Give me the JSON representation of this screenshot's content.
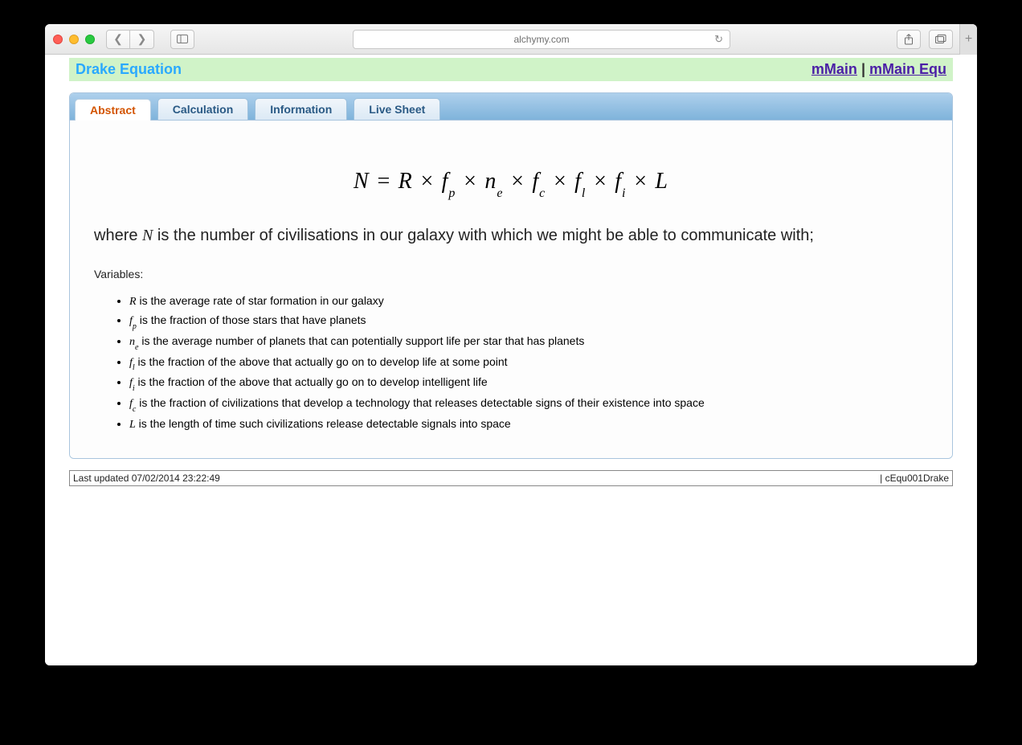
{
  "browser": {
    "address": "alchymy.com"
  },
  "banner": {
    "title": "Drake Equation",
    "link1": "mMain",
    "sep": " | ",
    "link2": "mMain Equ"
  },
  "tabs": [
    {
      "label": "Abstract"
    },
    {
      "label": "Calculation"
    },
    {
      "label": "Information"
    },
    {
      "label": "Live Sheet"
    }
  ],
  "equation_html": "N = R × f<sub>p</sub> × n<sub>e</sub> × f<sub>c</sub> × f<sub>l</sub> × f<sub>i</sub> × L",
  "description": {
    "prefix": "where ",
    "symbol": "N",
    "rest": " is the number of civilisations in our galaxy with which we might be able to communicate with;"
  },
  "variables_label": "Variables:",
  "variables": [
    {
      "sym": "R",
      "sub": "",
      "text": " is the average rate of star formation in our galaxy"
    },
    {
      "sym": "f",
      "sub": "p",
      "text": " is the fraction of those stars that have planets"
    },
    {
      "sym": "n",
      "sub": "e",
      "text": " is the average number of planets that can potentially support life per star that has planets"
    },
    {
      "sym": "f",
      "sub": "l",
      "text": " is the fraction of the above that actually go on to develop life at some point"
    },
    {
      "sym": "f",
      "sub": "i",
      "text": " is the fraction of the above that actually go on to develop intelligent life"
    },
    {
      "sym": "f",
      "sub": "c",
      "text": " is the fraction of civilizations that develop a technology that releases detectable signs of their existence into space"
    },
    {
      "sym": "L",
      "sub": "",
      "text": " is the length of time such civilizations release detectable signals into space"
    }
  ],
  "footer": {
    "left": "Last updated 07/02/2014 23:22:49",
    "right": "| cEqu001Drake"
  }
}
